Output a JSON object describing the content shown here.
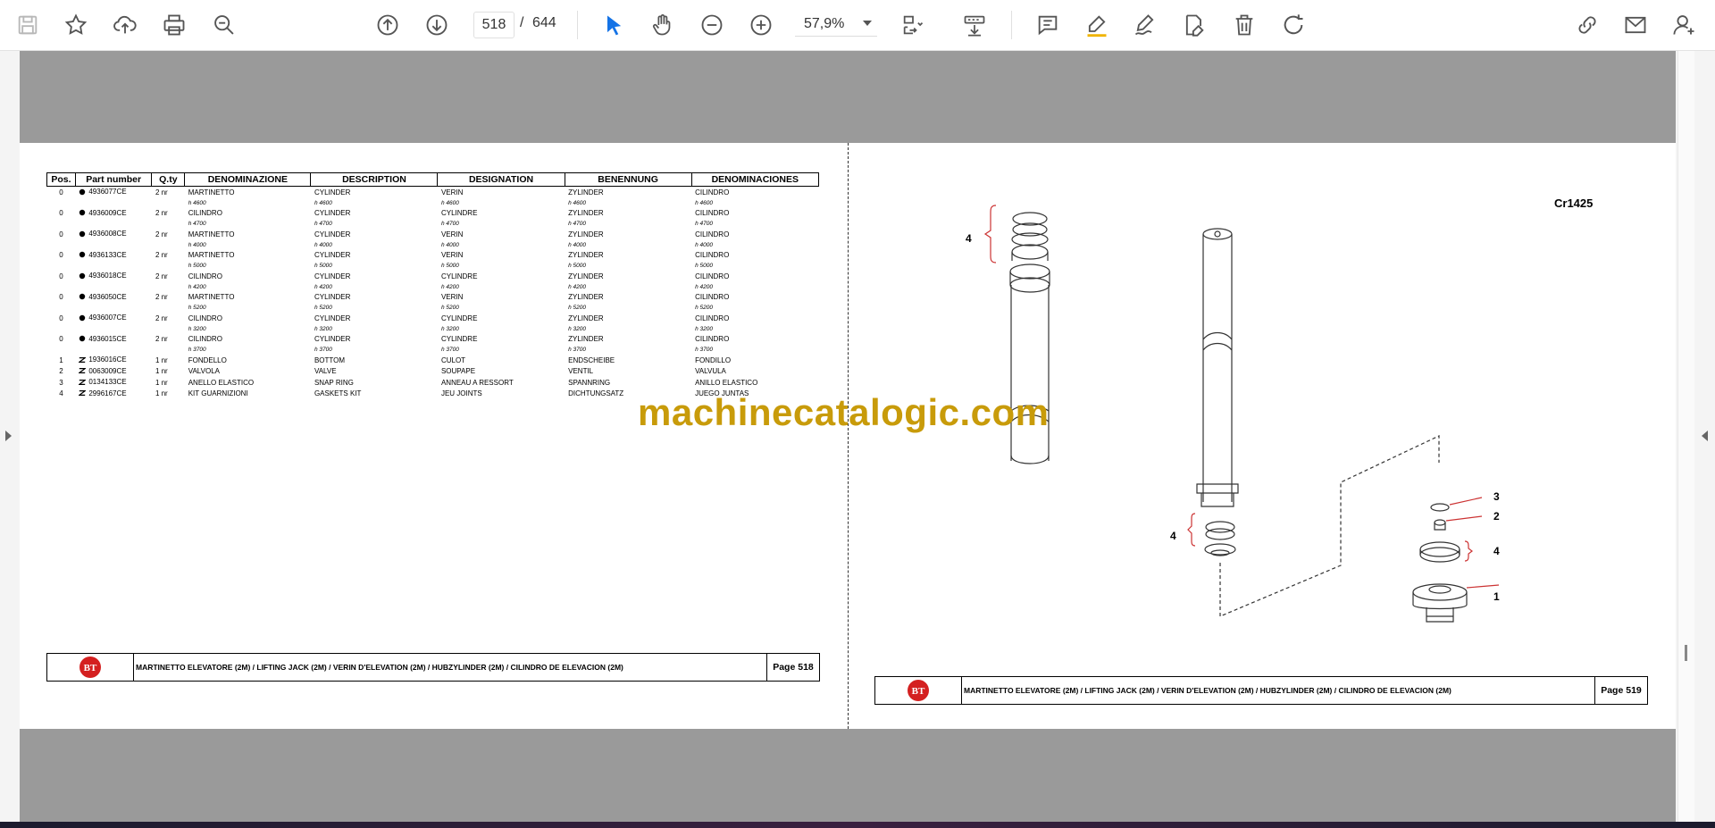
{
  "toolbar": {
    "page_current": "518",
    "page_separator": "/",
    "page_total": "644",
    "zoom": "57,9%",
    "icons": [
      "save-icon",
      "bookmark-star-icon",
      "upload-icon",
      "print-icon",
      "find-icon",
      "page-up-icon",
      "page-down-icon",
      "select-cursor-icon",
      "hand-icon",
      "zoom-out-icon",
      "zoom-in-icon",
      "fit-page-icon",
      "scroll-mode-icon",
      "comment-icon",
      "highlight-icon",
      "draw-icon",
      "fill-sign-icon",
      "delete-icon",
      "rotate-icon",
      "share-link-icon",
      "email-icon",
      "account-icon"
    ]
  },
  "table": {
    "headers": [
      "Pos.",
      "Part number",
      "Q.ty",
      "DENOMINAZIONE",
      "DESCRIPTION",
      "DESIGNATION",
      "BENENNUNG",
      "DENOMINACIONES"
    ],
    "rows": [
      {
        "pos": "0",
        "part": "4936077CE",
        "qty": "2 nr",
        "it": "MARTINETTO",
        "en": "CYLINDER",
        "fr": "VERIN",
        "de": "ZYLINDER",
        "es": "CILINDRO",
        "sub": "h 4600"
      },
      {
        "pos": "0",
        "part": "4936009CE",
        "qty": "2 nr",
        "it": "CILINDRO",
        "en": "CYLINDER",
        "fr": "CYLINDRE",
        "de": "ZYLINDER",
        "es": "CILINDRO",
        "sub": "h 4700"
      },
      {
        "pos": "0",
        "part": "4936008CE",
        "qty": "2 nr",
        "it": "MARTINETTO",
        "en": "CYLINDER",
        "fr": "VERIN",
        "de": "ZYLINDER",
        "es": "CILINDRO",
        "sub": "h 4000"
      },
      {
        "pos": "0",
        "part": "4936133CE",
        "qty": "2 nr",
        "it": "MARTINETTO",
        "en": "CYLINDER",
        "fr": "VERIN",
        "de": "ZYLINDER",
        "es": "CILINDRO",
        "sub": "h 5000"
      },
      {
        "pos": "0",
        "part": "4936018CE",
        "qty": "2 nr",
        "it": "CILINDRO",
        "en": "CYLINDER",
        "fr": "CYLINDRE",
        "de": "ZYLINDER",
        "es": "CILINDRO",
        "sub": "h 4200"
      },
      {
        "pos": "0",
        "part": "4936050CE",
        "qty": "2 nr",
        "it": "MARTINETTO",
        "en": "CYLINDER",
        "fr": "VERIN",
        "de": "ZYLINDER",
        "es": "CILINDRO",
        "sub": "h 5200"
      },
      {
        "pos": "0",
        "part": "4936007CE",
        "qty": "2 nr",
        "it": "CILINDRO",
        "en": "CYLINDER",
        "fr": "CYLINDRE",
        "de": "ZYLINDER",
        "es": "CILINDRO",
        "sub": "h 3200"
      },
      {
        "pos": "0",
        "part": "4936015CE",
        "qty": "2 nr",
        "it": "CILINDRO",
        "en": "CYLINDER",
        "fr": "CYLINDRE",
        "de": "ZYLINDER",
        "es": "CILINDRO",
        "sub": "h 3700"
      },
      {
        "pos": "1",
        "part": "1936016CE",
        "qty": "1 nr",
        "it": "FONDELLO",
        "en": "BOTTOM",
        "fr": "CULOT",
        "de": "ENDSCHEIBE",
        "es": "FONDILLO",
        "sub": ""
      },
      {
        "pos": "2",
        "part": "0063009CE",
        "qty": "1 nr",
        "it": "VALVOLA",
        "en": "VALVE",
        "fr": "SOUPAPE",
        "de": "VENTIL",
        "es": "VALVULA",
        "sub": ""
      },
      {
        "pos": "3",
        "part": "0134133CE",
        "qty": "1 nr",
        "it": "ANELLO ELASTICO",
        "en": "SNAP RING",
        "fr": "ANNEAU A RESSORT",
        "de": "SPANNRING",
        "es": "ANILLO ELASTICO",
        "sub": ""
      },
      {
        "pos": "4",
        "part": "2996167CE",
        "qty": "1 nr",
        "it": "KIT GUARNIZIONI",
        "en": "GASKETS KIT",
        "fr": "JEU JOINTS",
        "de": "DICHTUNGSATZ",
        "es": "JUEGO JUNTAS",
        "sub": ""
      }
    ]
  },
  "left_footer": {
    "title": "MARTINETTO ELEVATORE (2M) / LIFTING JACK (2M) / VERIN D'ELEVATION (2M) / HUBZYLINDER (2M) / CILINDRO DE ELEVACION (2M)",
    "page": "Page 518",
    "logo": "BT"
  },
  "right_footer": {
    "title": "MARTINETTO ELEVATORE (2M) / LIFTING JACK (2M) / VERIN D'ELEVATION (2M) / HUBZYLINDER (2M) / CILINDRO DE ELEVACION (2M)",
    "page": "Page 519",
    "logo": "BT"
  },
  "drawing": {
    "code": "Cr1425",
    "callouts": [
      "4",
      "4",
      "3",
      "2",
      "4",
      "1"
    ]
  },
  "watermark": "machinecatalogic.com",
  "colors": {
    "accent": "#1473e6",
    "viewer_bg": "#9a9a9a",
    "watermark": "#c89b0a",
    "logo_red": "#d42020"
  }
}
